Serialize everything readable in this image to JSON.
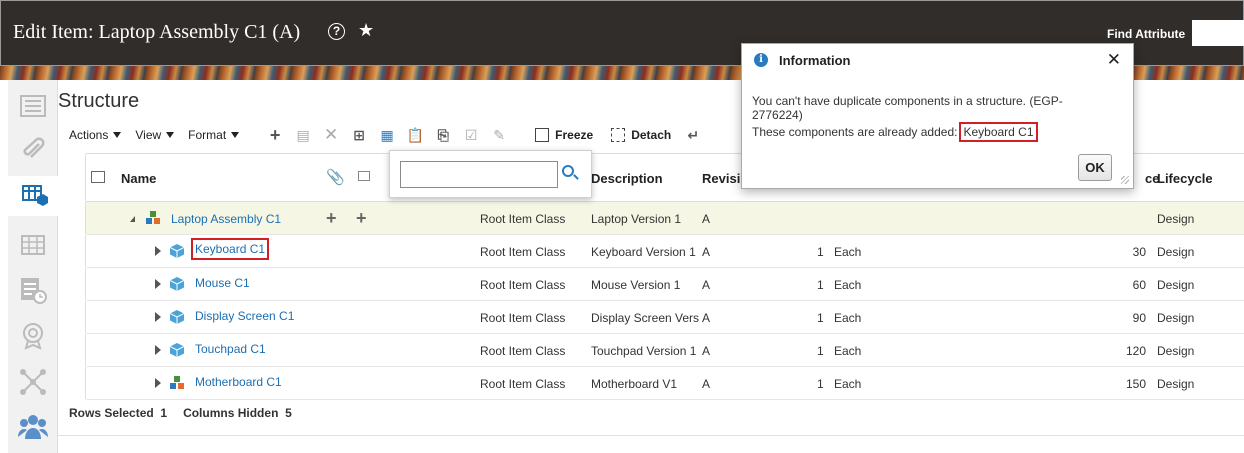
{
  "header": {
    "title": "Edit Item: Laptop Assembly C1 (A)",
    "help_glyph": "?",
    "star_glyph": "★",
    "find_attribute_label": "Find Attribute",
    "find_attribute_value": ""
  },
  "section_title": "Structure",
  "toolbar": {
    "actions_label": "Actions",
    "view_label": "View",
    "format_label": "Format",
    "freeze_label": "Freeze",
    "detach_label": "Detach"
  },
  "table": {
    "headers": {
      "name": "Name",
      "description": "Description",
      "revision": "Revisi",
      "price": "ce",
      "lifecycle": "Lifecycle"
    },
    "rows": [
      {
        "name": "Laptop Assembly C1",
        "class": "Root Item Class",
        "description": "Laptop Version 1",
        "revision": "A",
        "qty": "",
        "uom": "",
        "price": "",
        "lifecycle": "Design"
      },
      {
        "name": "Keyboard C1",
        "class": "Root Item Class",
        "description": "Keyboard Version 1",
        "revision": "A",
        "qty": "1",
        "uom": "Each",
        "price": "30",
        "lifecycle": "Design"
      },
      {
        "name": "Mouse C1",
        "class": "Root Item Class",
        "description": "Mouse Version 1",
        "revision": "A",
        "qty": "1",
        "uom": "Each",
        "price": "60",
        "lifecycle": "Design"
      },
      {
        "name": "Display Screen C1",
        "class": "Root Item Class",
        "description": "Display Screen Vers",
        "revision": "A",
        "qty": "1",
        "uom": "Each",
        "price": "90",
        "lifecycle": "Design"
      },
      {
        "name": "Touchpad C1",
        "class": "Root Item Class",
        "description": "Touchpad Version 1",
        "revision": "A",
        "qty": "1",
        "uom": "Each",
        "price": "120",
        "lifecycle": "Design"
      },
      {
        "name": "Motherboard C1",
        "class": "Root Item Class",
        "description": "Motherboard V1",
        "revision": "A",
        "qty": "1",
        "uom": "Each",
        "price": "150",
        "lifecycle": "Design"
      }
    ]
  },
  "footer": {
    "rows_selected_label": "Rows Selected",
    "rows_selected_value": "1",
    "columns_hidden_label": "Columns Hidden",
    "columns_hidden_value": "5"
  },
  "search_popup": {
    "value": ""
  },
  "dialog": {
    "title": "Information",
    "close_glyph": "✕",
    "message_line1": "You can't have duplicate components in a structure. (EGP-2776224)",
    "message_line2": "These components are already added:",
    "added_component": "Keyboard C1",
    "ok_label": "OK"
  },
  "colors": {
    "header_bg": "#312d2a",
    "link": "#1b6fb3",
    "highlight": "#d21f26",
    "selected_row": "#f6f6e4"
  }
}
